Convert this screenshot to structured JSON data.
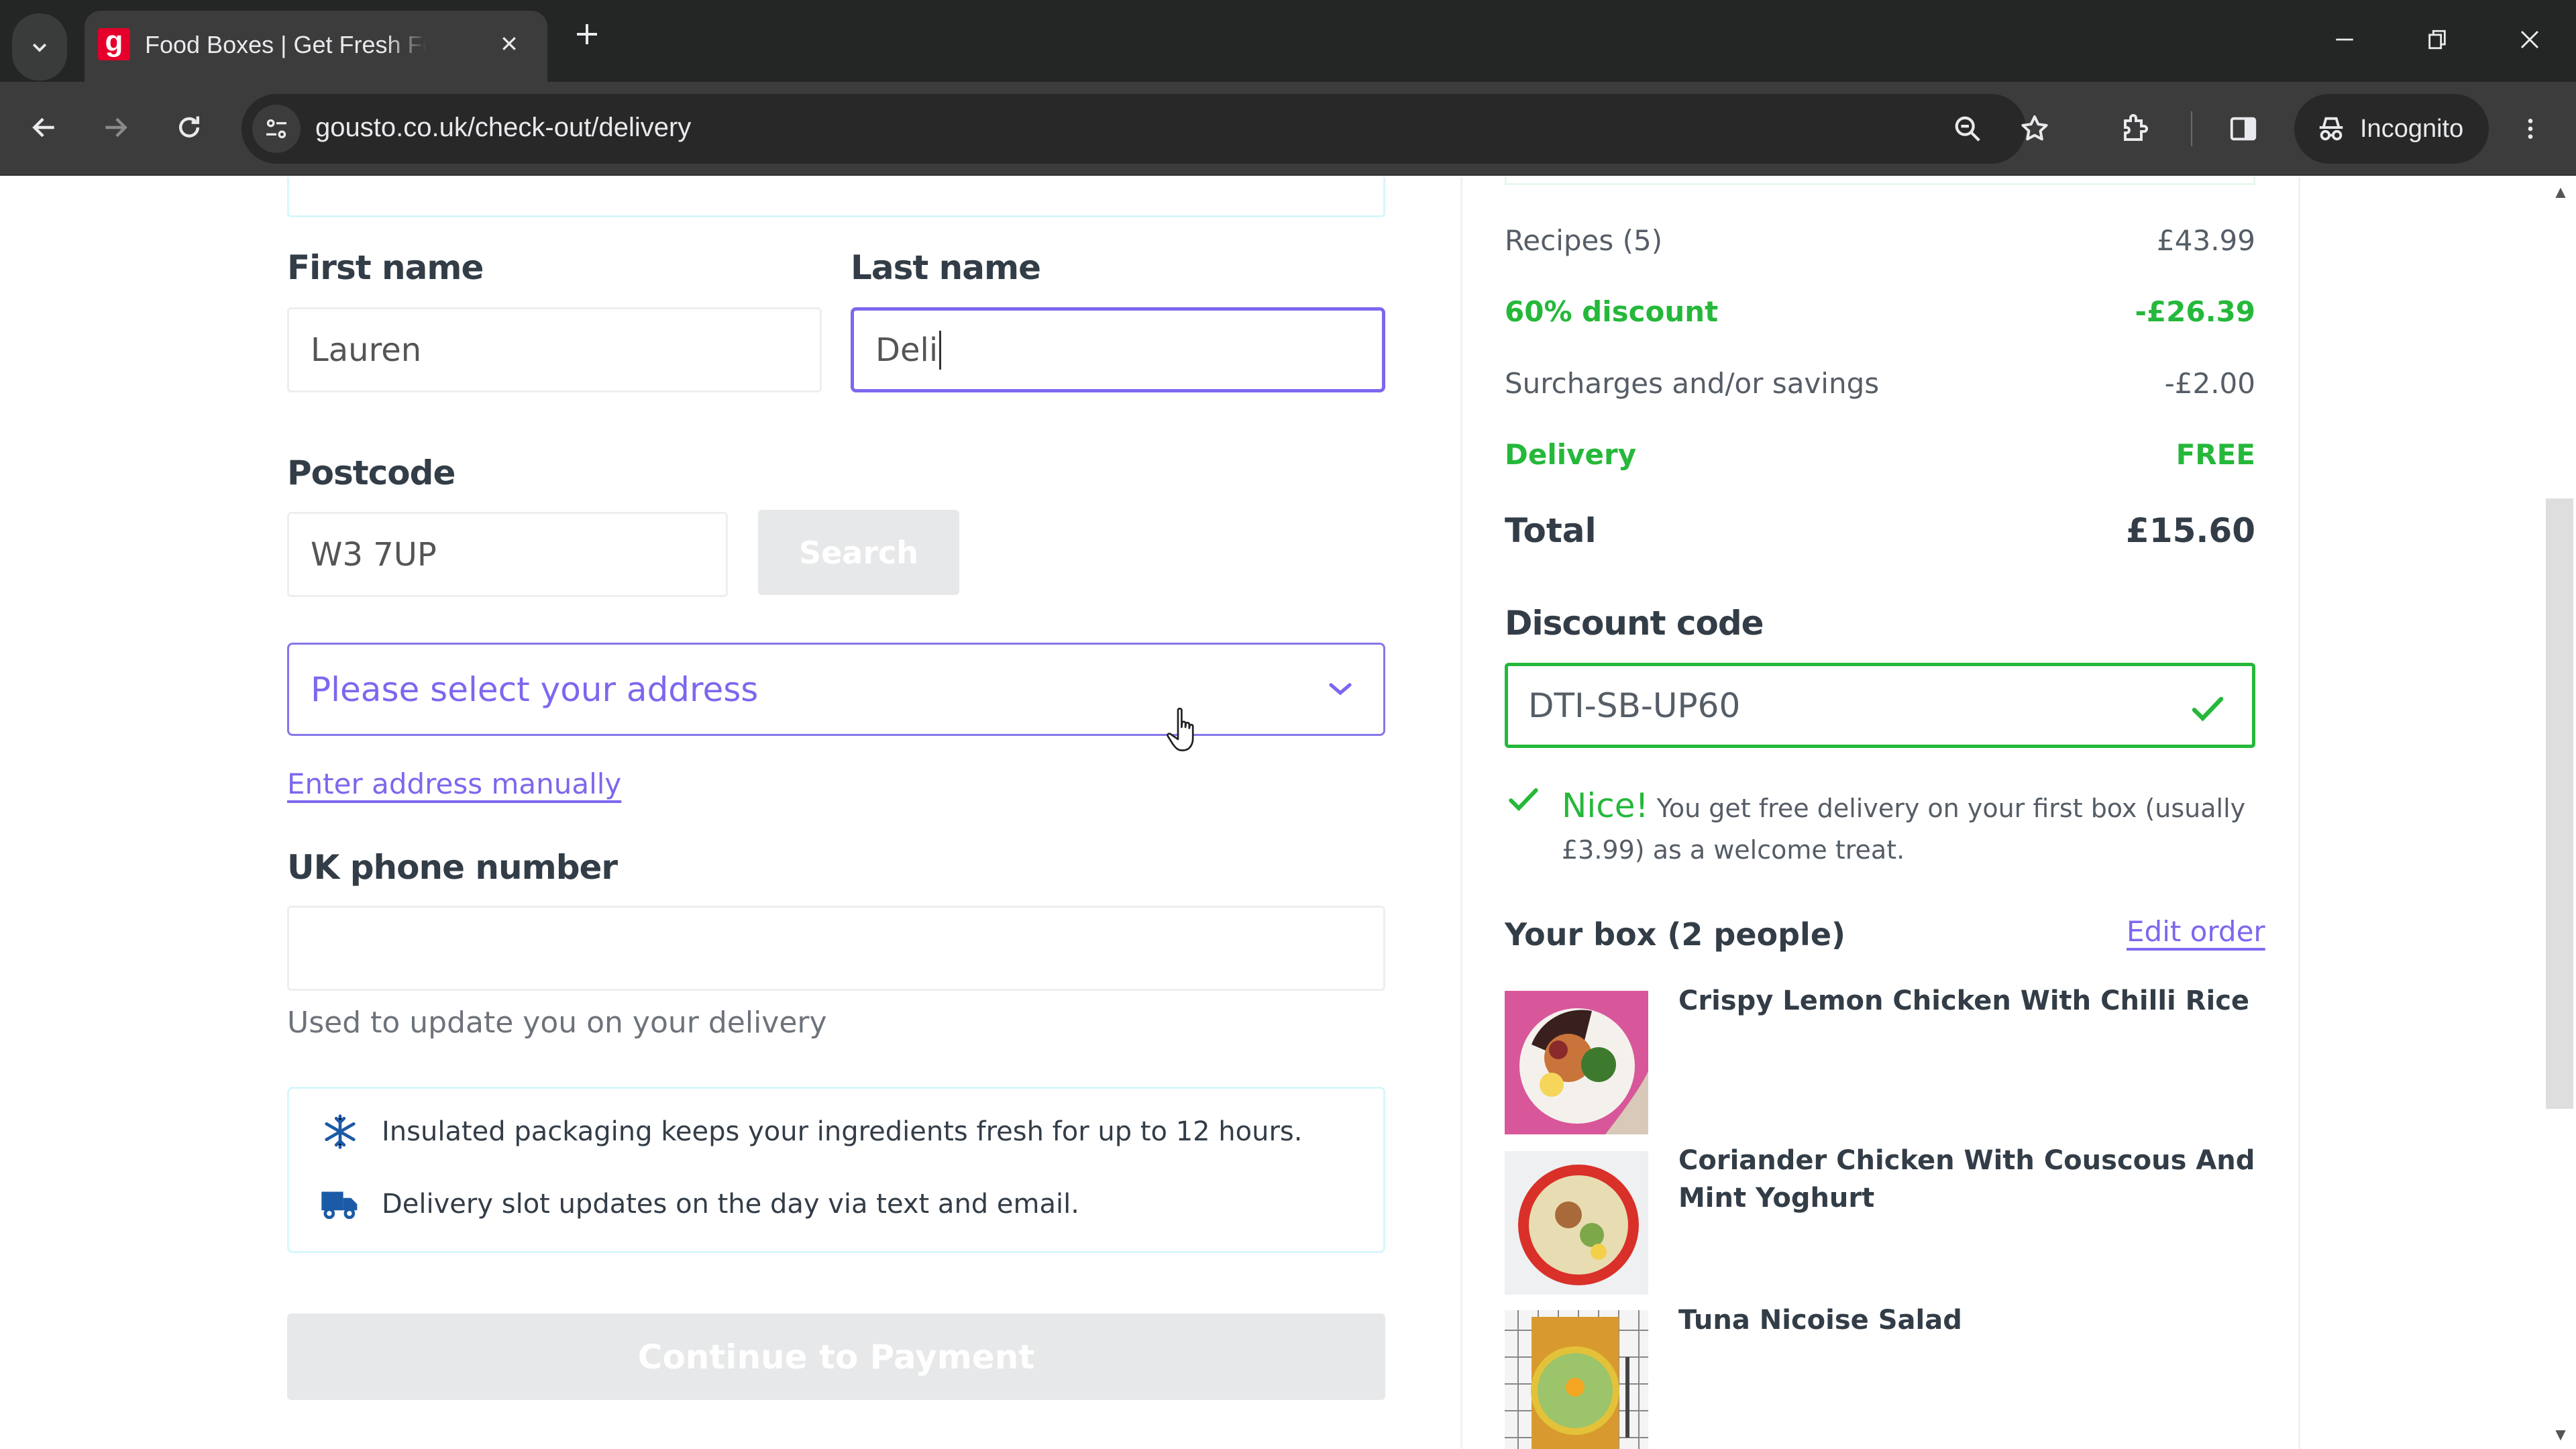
{
  "browser": {
    "tab": {
      "title": "Food Boxes | Get Fresh Food & Recipes Delivered",
      "favicon_letter": "g",
      "favicon_color": "#e4002b"
    },
    "url": "gousto.co.uk/check-out/delivery",
    "profile_label": "Incognito",
    "icons": [
      "tab-search-icon",
      "close-icon",
      "new-tab-icon",
      "minimize-icon",
      "restore-icon",
      "close-window-icon",
      "back-icon",
      "forward-icon",
      "reload-icon",
      "site-info-icon",
      "zoom-icon",
      "bookmark-star-icon",
      "extensions-icon",
      "side-panel-icon",
      "incognito-icon",
      "menu-icon"
    ]
  },
  "form": {
    "first_name": {
      "label": "First name",
      "value": "Lauren"
    },
    "last_name": {
      "label": "Last name",
      "value": "Deli"
    },
    "postcode": {
      "label": "Postcode",
      "value": "W3 7UP",
      "search_label": "Search"
    },
    "address": {
      "placeholder": "Please select your address"
    },
    "manual_address_link": "Enter address manually",
    "phone": {
      "label": "UK phone number",
      "value": "",
      "helper": "Used to update you on your delivery"
    },
    "info": [
      {
        "icon": "snowflake-icon",
        "text": "Insulated packaging keeps your ingredients fresh for up to 12 hours."
      },
      {
        "icon": "truck-icon",
        "text": "Delivery slot updates on the day via text and email."
      }
    ],
    "continue_label": "Continue to Payment"
  },
  "summary": {
    "rows": [
      {
        "label": "Recipes (5)",
        "value": "£43.99",
        "style": "normal"
      },
      {
        "label": "60% discount",
        "value": "-£26.39",
        "style": "green"
      },
      {
        "label": "Surcharges and/or savings",
        "value": "-£2.00",
        "style": "normal"
      },
      {
        "label": "Delivery",
        "value": "FREE",
        "style": "green"
      }
    ],
    "total": {
      "label": "Total",
      "value": "£15.60"
    },
    "discount": {
      "label": "Discount code",
      "value": "DTI-SB-UP60",
      "status": "valid",
      "message_strong": "Nice!",
      "message": "You get free delivery on your first box (usually £3.99) as a welcome treat."
    },
    "box": {
      "title": "Your box (2 people)",
      "edit_label": "Edit order",
      "recipes": [
        {
          "name": "Crispy Lemon Chicken With Chilli Rice"
        },
        {
          "name": "Coriander Chicken With Couscous And Mint Yoghurt"
        },
        {
          "name": "Tuna Nicoise Salad"
        }
      ]
    }
  },
  "colors": {
    "accent_purple": "#7b68ee",
    "success_green": "#25b83a",
    "text_dark": "#333d47",
    "info_blue": "#1b5aa6",
    "brand_red": "#e4002b"
  }
}
